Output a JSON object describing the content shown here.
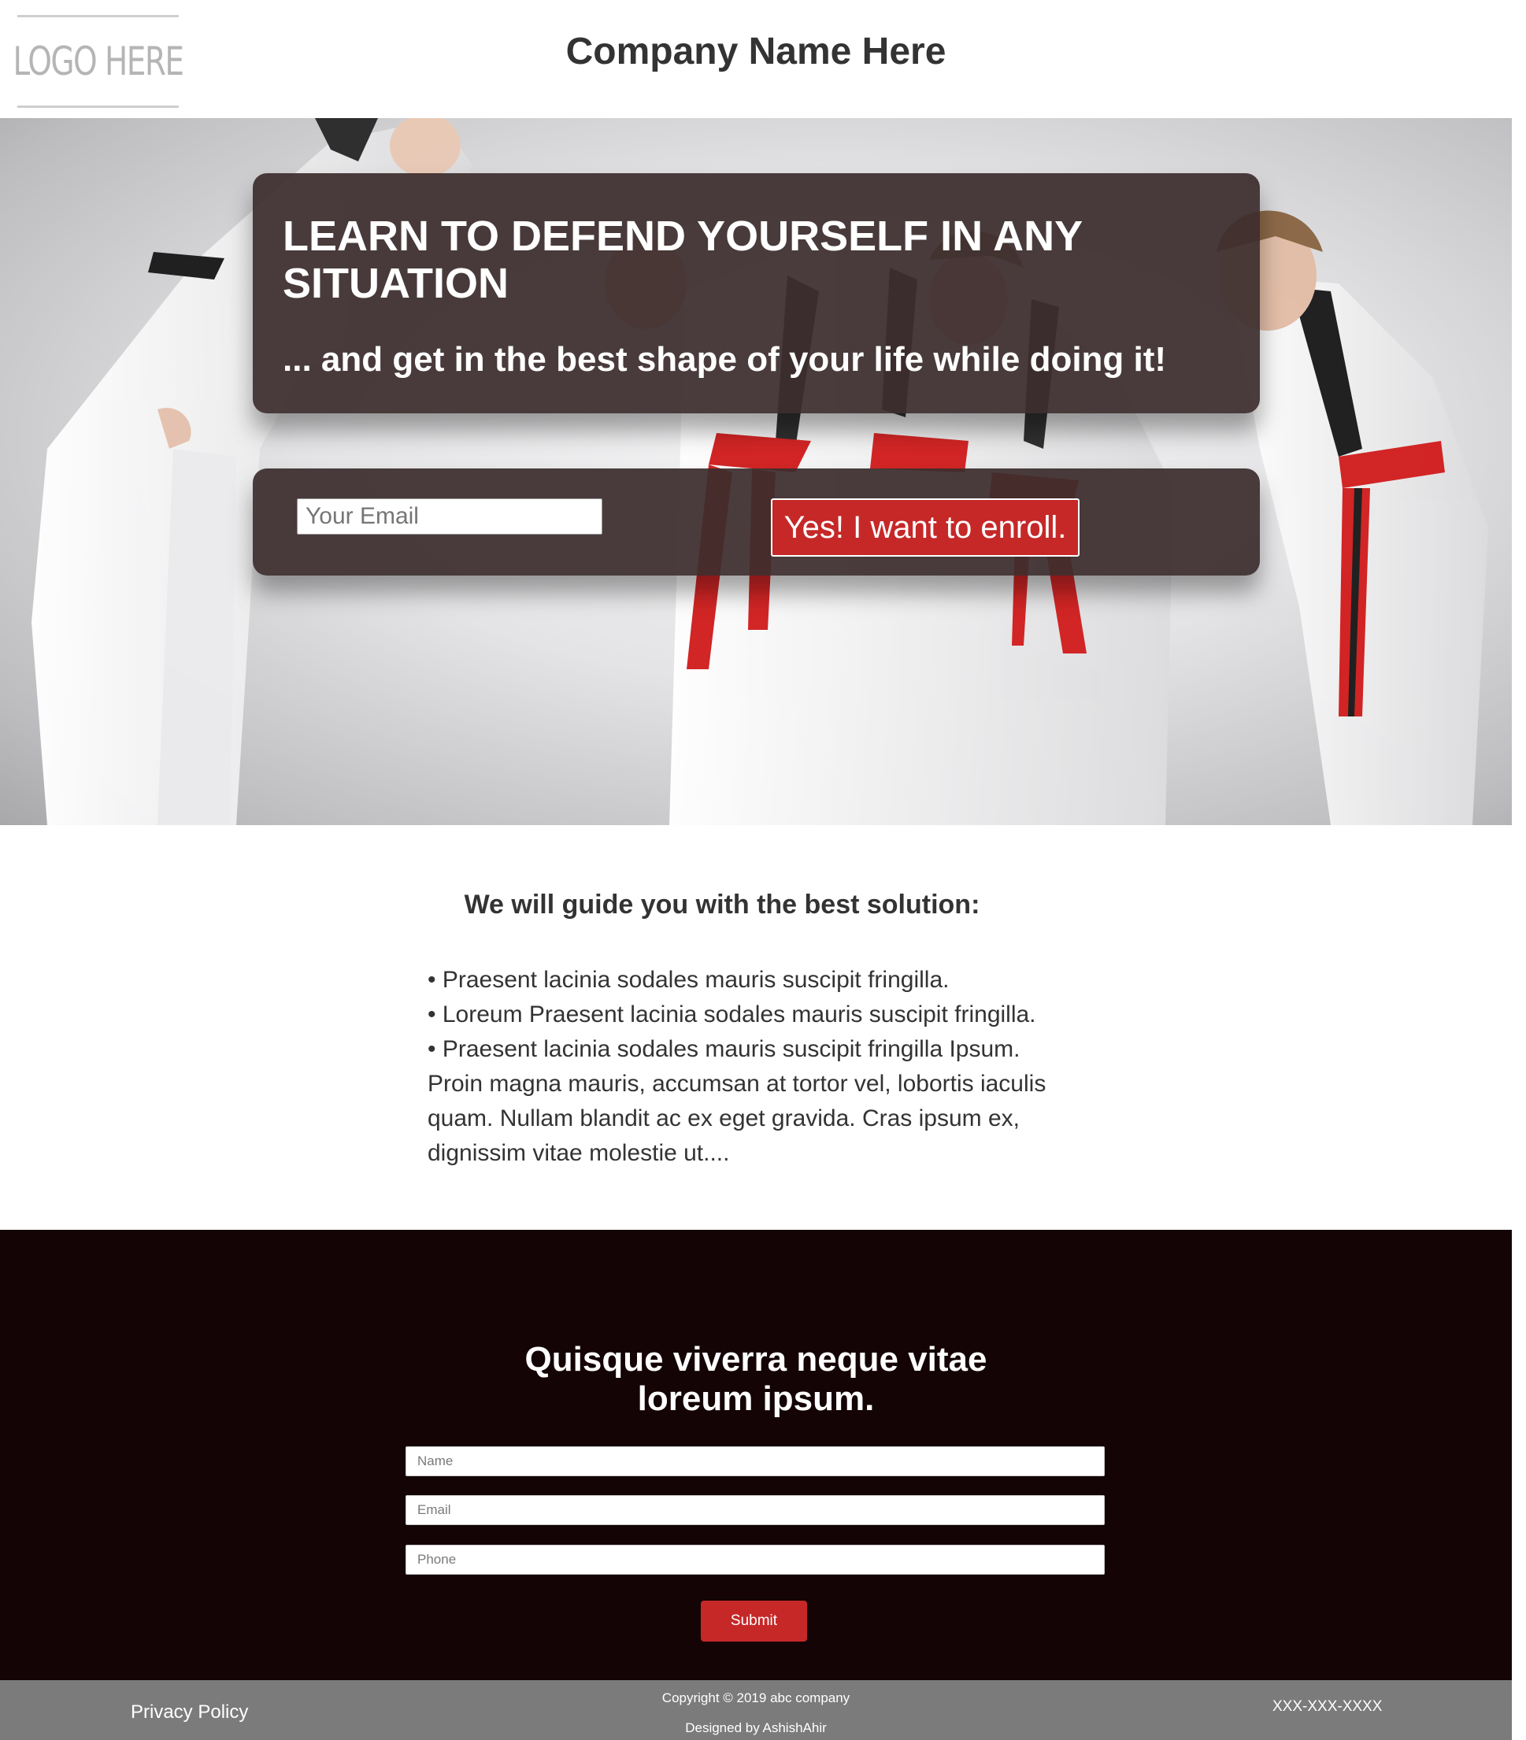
{
  "header": {
    "logo_text": "LOGO HERE",
    "company_name": "Company Name Here"
  },
  "hero": {
    "headline": "LEARN TO DEFEND YOURSELF IN ANY SITUATION",
    "subheadline": "... and get in the best shape of your life while doing it!",
    "email_placeholder": "Your Email",
    "enroll_button": "Yes! I want to enroll.",
    "image_description_icons": [
      "martial-arts-photo"
    ]
  },
  "content": {
    "title": "We will guide you with the best solution:",
    "bullets": [
      "• Praesent lacinia sodales mauris suscipit fringilla.",
      "• Loreum Praesent lacinia sodales mauris suscipit fringilla.",
      "• Praesent lacinia sodales mauris suscipit fringilla Ipsum."
    ],
    "paragraph": "Proin magna mauris, accumsan at tortor vel, lobortis iaculis quam. Nullam blandit ac ex eget gravida. Cras ipsum ex, dignissim vitae molestie ut...."
  },
  "contact": {
    "title_line1": "Quisque viverra neque vitae",
    "title_line2": "loreum ipsum.",
    "name_placeholder": "Name",
    "email_placeholder": "Email",
    "phone_placeholder": "Phone",
    "submit_label": "Submit"
  },
  "footer": {
    "privacy": "Privacy Policy",
    "copyright": "Copyright © 2019 abc company",
    "designed_by": "Designed by AshishAhir",
    "phone": "XXX-XXX-XXXX"
  },
  "colors": {
    "accent_red": "#c62828",
    "contact_bg": "#140405",
    "footer_bg": "#7b7b7b",
    "panel_bg": "#3c2d2d"
  }
}
